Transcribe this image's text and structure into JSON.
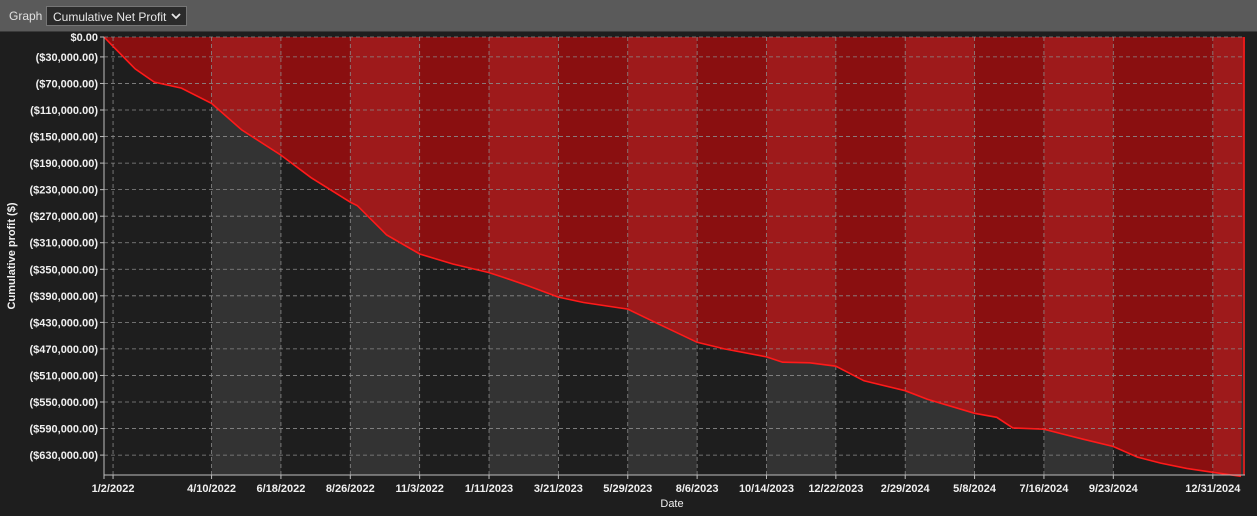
{
  "toolbar": {
    "graph_label": "Graph",
    "graph_select_value": "Cumulative Net Profit"
  },
  "colors": {
    "background": "#1e1e1e",
    "band_dark": "#1e1e1e",
    "band_light": "#333333",
    "red_band_dark": "#8a0f10",
    "red_band_light": "#9e1a1b",
    "line": "#ff1a1a",
    "grid": "#8a8a8a",
    "axis_text": "#f0f0f0"
  },
  "icons": {
    "select_chevron": "chevron-down-icon"
  },
  "chart_data": {
    "type": "area",
    "title": "",
    "xlabel": "Date",
    "ylabel": "Cumulative profit ($)",
    "grid": true,
    "y_ticks": [
      0,
      -30000,
      -70000,
      -110000,
      -150000,
      -190000,
      -230000,
      -270000,
      -310000,
      -350000,
      -390000,
      -430000,
      -470000,
      -510000,
      -550000,
      -590000,
      -630000
    ],
    "y_tick_labels": [
      "$0.00",
      "($30,000.00)",
      "($70,000.00)",
      "($110,000.00)",
      "($150,000.00)",
      "($190,000.00)",
      "($230,000.00)",
      "($270,000.00)",
      "($310,000.00)",
      "($350,000.00)",
      "($390,000.00)",
      "($430,000.00)",
      "($470,000.00)",
      "($510,000.00)",
      "($550,000.00)",
      "($590,000.00)",
      "($630,000.00)"
    ],
    "x_tick_labels": [
      "1/2/2022",
      "4/10/2022",
      "6/18/2022",
      "8/26/2022",
      "11/3/2022",
      "1/11/2023",
      "3/21/2023",
      "5/29/2023",
      "8/6/2023",
      "10/14/2023",
      "12/22/2023",
      "2/29/2024",
      "5/8/2024",
      "7/16/2024",
      "9/23/2024",
      "12/31/2024"
    ],
    "x_range": [
      "12/24/2021",
      "2/1/2025"
    ],
    "y_range": [
      -660000,
      0
    ],
    "series": [
      {
        "x": [
          "12/24/2021",
          "1/2/2022",
          "1/24/2022",
          "2/12/2022",
          "3/11/2022",
          "4/10/2022",
          "5/10/2022",
          "6/18/2022",
          "7/18/2022",
          "8/26/2022",
          "9/2/2022",
          "10/1/2022",
          "11/3/2022",
          "12/6/2022",
          "1/11/2023",
          "1/25/2023",
          "2/19/2023",
          "3/21/2023",
          "4/15/2023",
          "5/29/2023",
          "6/28/2023",
          "8/6/2023",
          "9/2/2023",
          "10/14/2023",
          "10/30/2023",
          "11/26/2023",
          "12/22/2023",
          "1/19/2024",
          "2/29/2024",
          "3/22/2024",
          "5/8/2024",
          "5/30/2024",
          "6/15/2024",
          "7/16/2024",
          "8/3/2024",
          "8/24/2024",
          "9/23/2024",
          "10/17/2024",
          "11/9/2024",
          "12/5/2024",
          "12/31/2024",
          "1/28/2025"
        ],
        "values": [
          0,
          -14000,
          -48000,
          -68000,
          -77000,
          -100000,
          -140000,
          -178000,
          -212000,
          -249000,
          -254000,
          -298000,
          -327000,
          -342000,
          -355000,
          -362000,
          -375000,
          -392000,
          -400000,
          -410000,
          -432000,
          -460000,
          -470000,
          -482000,
          -490000,
          -491000,
          -496000,
          -518000,
          -533000,
          -546000,
          -567000,
          -573000,
          -589000,
          -591000,
          -598000,
          -606000,
          -617000,
          -633000,
          -642000,
          -650000,
          -656000,
          -662000
        ]
      }
    ]
  }
}
